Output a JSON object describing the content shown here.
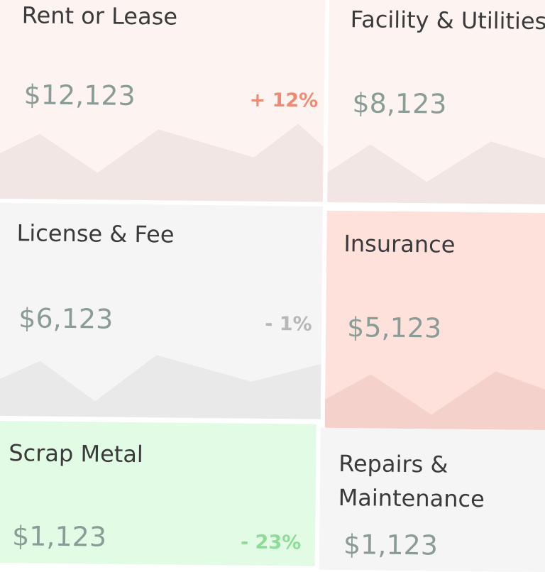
{
  "cards": [
    {
      "title": "Rent or Lease",
      "amount": "$12,123",
      "change": "+ 12%"
    },
    {
      "title": "Facility & Utilities",
      "amount": "$8,123",
      "change": ""
    },
    {
      "title": "License & Fee",
      "amount": "$6,123",
      "change": "- 1%"
    },
    {
      "title": "Insurance",
      "amount": "$5,123",
      "change": ""
    },
    {
      "title": "Scrap Metal",
      "amount": "$1,123",
      "change": "- 23%"
    },
    {
      "title": "Repairs & Maintenance",
      "title_line1": "Repairs &",
      "title_line2": "Maintenance",
      "amount": "$1,123",
      "change": ""
    }
  ],
  "colors": {
    "rent_bg": "#fdf3f1",
    "facility_bg": "#fdf3f1",
    "license_bg": "#f5f5f5",
    "insurance_bg": "#fde1da",
    "scrap_bg": "#e2fbe4",
    "repairs_bg": "#f5f5f5",
    "positive_change": "#f08a72",
    "neutral_change": "#b7b7b7",
    "negative_change": "#8fdc9a"
  }
}
